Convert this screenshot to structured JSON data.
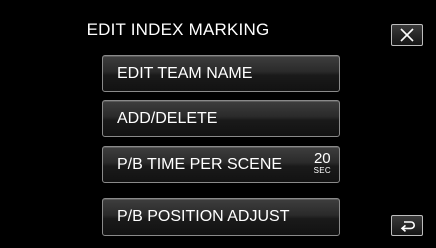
{
  "screen": {
    "title": "EDIT INDEX MARKING"
  },
  "menu": {
    "items": [
      {
        "label": "EDIT TEAM NAME"
      },
      {
        "label": "ADD/DELETE"
      },
      {
        "label": "P/B TIME PER SCENE",
        "value": "20",
        "unit": "SEC"
      },
      {
        "label": "P/B POSITION ADJUST"
      }
    ]
  },
  "icons": {
    "close": "close-icon",
    "back": "back-arrow-icon"
  },
  "colors": {
    "background": "#000000",
    "button_border": "#8a8a8a",
    "text": "#ffffff"
  }
}
